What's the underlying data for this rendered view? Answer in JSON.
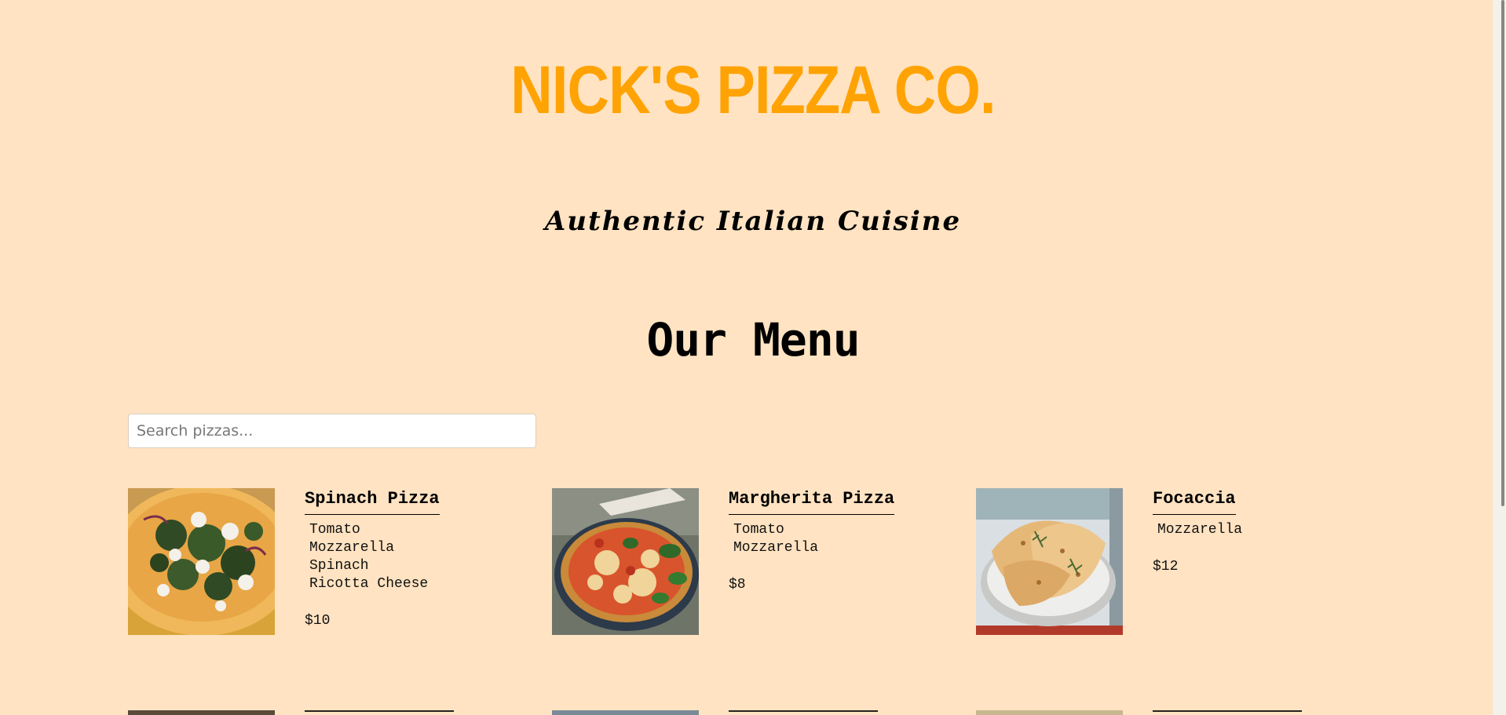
{
  "header": {
    "title": "NICK'S PIZZA CO.",
    "tagline": "Authentic Italian Cuisine"
  },
  "menu": {
    "heading": "Our Menu",
    "search": {
      "placeholder": "Search pizzas...",
      "value": ""
    },
    "items": [
      {
        "name": "Spinach Pizza",
        "ingredients": [
          "Tomato",
          "Mozzarella",
          "Spinach",
          "Ricotta Cheese"
        ],
        "price": "$10",
        "image": "spinach-pizza-photo"
      },
      {
        "name": "Margherita Pizza",
        "ingredients": [
          "Tomato",
          "Mozzarella"
        ],
        "price": "$8",
        "image": "margherita-pizza-photo"
      },
      {
        "name": "Focaccia",
        "ingredients": [
          "Mozzarella"
        ],
        "price": "$12",
        "image": "focaccia-photo"
      }
    ]
  },
  "colors": {
    "background": "#ffe3c2",
    "title": "#ffa304",
    "text": "#000000"
  }
}
